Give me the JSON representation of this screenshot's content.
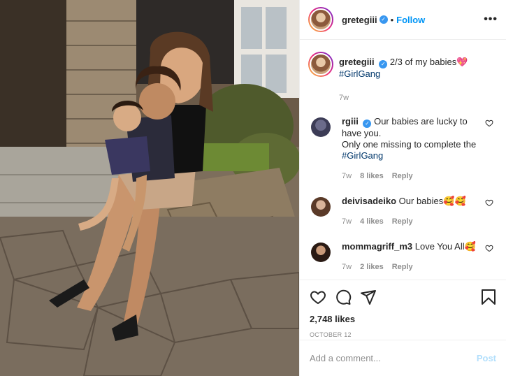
{
  "header": {
    "username": "gretegiii",
    "separator": "•",
    "follow_label": "Follow",
    "more_label": "•••"
  },
  "caption": {
    "username": "gretegiii",
    "text": "2/3 of my babies💖",
    "hashtag": "#GirlGang",
    "time": "7w"
  },
  "comments": [
    {
      "username": "rgiii",
      "verified": true,
      "line1": "Our babies are lucky to have you.",
      "line2": "Only one missing to complete the",
      "hashtag": "#GirlGang",
      "time": "7w",
      "likes": "8 likes",
      "reply": "Reply"
    },
    {
      "username": "deivisadeiko",
      "text": "Our babies🥰🥰",
      "time": "7w",
      "likes": "4 likes",
      "reply": "Reply"
    },
    {
      "username": "mommagriff_m3",
      "text": "Love You All🥰",
      "time": "7w",
      "likes": "2 likes",
      "reply": "Reply"
    }
  ],
  "actions": {
    "likes_count": "2,748 likes",
    "date": "OCTOBER 12"
  },
  "add_comment": {
    "placeholder": "Add a comment...",
    "post_label": "Post"
  },
  "icons": {
    "like": "heart-icon",
    "comment": "comment-icon",
    "share": "share-icon",
    "save": "bookmark-icon",
    "verified": "verified-badge-icon"
  },
  "colors": {
    "accent": "#0095f6",
    "verified": "#3897f0",
    "hashtag": "#00376b",
    "muted": "#8e8e8e",
    "post_disabled": "#b2dffc"
  }
}
